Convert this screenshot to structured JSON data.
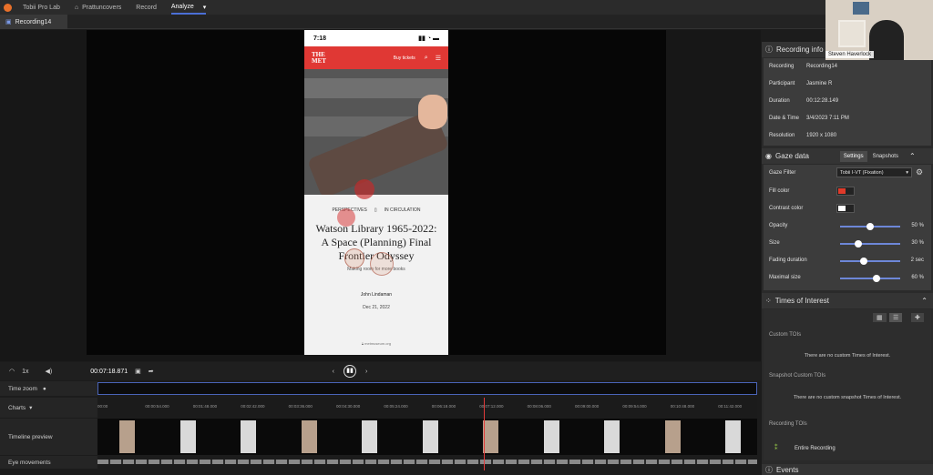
{
  "topbar": {
    "app": "Tobii Pro Lab",
    "project": "Prattuncovers",
    "record": "Record",
    "analyze": "Analyze"
  },
  "tab": {
    "label": "Recording14"
  },
  "phone": {
    "time": "7:18",
    "logo": "THE MET",
    "buy": "Buy tickets",
    "tag1": "PERSPECTIVES",
    "tag2": "IN CIRCULATION",
    "title": "Watson Library 1965-2022: A Space (Planning) Final Frontier Odyssey",
    "subtitle": "Making room for more books",
    "author": "John Lindaman",
    "date": "Dec 21, 2022",
    "url": "metmuseum.org"
  },
  "controls": {
    "speed": "1x",
    "time": "00:07:18.871"
  },
  "rows": {
    "timezoom": "Time zoom",
    "charts": "Charts",
    "timeline": "Timeline preview",
    "eye": "Eye movements"
  },
  "ticks": [
    "00:00",
    "00:00:54.000",
    "00:01:48.000",
    "00:02:42.000",
    "00:03:36.000",
    "00:04:30.000",
    "00:05:24.000",
    "00:06:18.000",
    "00:07:12.000",
    "00:08:06.000",
    "00:09:00.000",
    "00:09:54.000",
    "00:10:48.000",
    "00:11:42.000"
  ],
  "webcam": {
    "name": "Steven Haverlock"
  },
  "recinfo": {
    "header": "Recording info",
    "rows": [
      {
        "k": "Recording",
        "v": "Recording14"
      },
      {
        "k": "Participant",
        "v": "Jasmine R"
      },
      {
        "k": "Duration",
        "v": "00:12:28.149"
      },
      {
        "k": "Date & Time",
        "v": "3/4/2023 7:11 PM"
      },
      {
        "k": "Resolution",
        "v": "1920 x 1080"
      }
    ]
  },
  "gaze": {
    "header": "Gaze data",
    "tab_settings": "Settings",
    "tab_snapshots": "Snapshots",
    "filter_label": "Gaze Filter",
    "filter_value": "Tobii I-VT (Fixation)",
    "fill_label": "Fill color",
    "contrast_label": "Contrast color",
    "fill_color": "#e03a2a",
    "contrast_color": "#ffffff",
    "sliders": [
      {
        "k": "Opacity",
        "v": "50 %",
        "frac": 0.5
      },
      {
        "k": "Size",
        "v": "30 %",
        "frac": 0.3
      },
      {
        "k": "Fading duration",
        "v": "2 sec",
        "frac": 0.4
      },
      {
        "k": "Maximal size",
        "v": "60 %",
        "frac": 0.6
      }
    ]
  },
  "toi": {
    "header": "Times of Interest",
    "custom": "Custom TOIs",
    "custom_empty": "There are no custom Times of Interest.",
    "snap": "Snapshot Custom TOIs",
    "snap_empty": "There are no custom snapshot Times of Interest.",
    "rec": "Recording TOIs",
    "entire": "Entire Recording"
  },
  "events": {
    "header": "Events"
  }
}
